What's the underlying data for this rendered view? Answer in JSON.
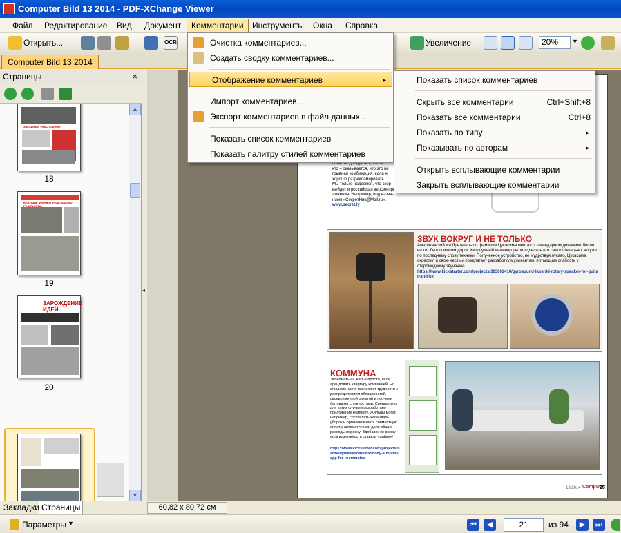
{
  "window": {
    "title": "Computer Bild 13 2014 - PDF-XChange Viewer"
  },
  "menubar": {
    "items": [
      "Файл",
      "Редактирование",
      "Вид",
      "Документ",
      "Комментарии",
      "Инструменты",
      "Окна",
      "Справка"
    ],
    "active_index": 4
  },
  "toolbar": {
    "open_label": "Открыть...",
    "ocr_label": "OCR",
    "zoom_label": "Увеличение",
    "zoom_value": "20%"
  },
  "doctab": {
    "label": "Computer Bild 13 2014"
  },
  "sidepanel": {
    "title": "Страницы",
    "close": "×",
    "pages": [
      {
        "num": "18",
        "headline": "ЗВЁЗДНЫЙ «НАСЛЕДНИК»"
      },
      {
        "num": "19",
        "headline": "ВЕДУЩИЕ ФИРМЫ ПРЕДСТАВЛЯЮТ РЕЗУЛЬТАТЫ"
      },
      {
        "num": "20",
        "headline": "ЗАРОЖДЕНИЕ ИДЕЙ"
      },
      {
        "num": "21",
        "headline": ""
      }
    ],
    "selected_page": "21"
  },
  "sidetabs": [
    "Закладки",
    "Страницы"
  ],
  "dimensions": "60,82 x 80,72 см",
  "statusbar": {
    "params_label": "Параметры",
    "current_page": "21",
    "of_label": "из 94"
  },
  "comments_menu": {
    "items": [
      {
        "label": "Очистка комментариев...",
        "icon": "eraser-icon"
      },
      {
        "label": "Создать сводку комментариев...",
        "icon": "summary-icon"
      },
      {
        "label": "Отображение комментариев",
        "submenu": true,
        "highlighted": true
      },
      {
        "label": "Импорт комментариев...",
        "icon": ""
      },
      {
        "label": "Экспорт комментариев в файл данных...",
        "icon": "export-icon"
      },
      {
        "label": "Показать список комментариев",
        "icon": ""
      },
      {
        "label": "Показать палитру стилей комментариев",
        "icon": ""
      }
    ]
  },
  "display_submenu": {
    "items": [
      {
        "label": "Показать список комментариев",
        "shortcut": ""
      },
      {
        "label": "Скрыть все комментарии",
        "shortcut": "Ctrl+Shift+8"
      },
      {
        "label": "Показать все комментарии",
        "shortcut": "Ctrl+8"
      },
      {
        "label": "Показать по типу",
        "submenu": true
      },
      {
        "label": "Показывать по авторам",
        "submenu": true
      },
      {
        "label": "Открыть всплывающие комментарии",
        "shortcut": ""
      },
      {
        "label": "Закрыть всплывающие комментарии",
        "shortcut": ""
      }
    ]
  },
  "article": {
    "top_text": [
      "попыток догадаться, кто вст",
      "кто – оказывается, что это ве",
      "грывная комбинация, если н",
      "хорошо разрекламировать.",
      "Мы только надеемся, что скор",
      "выйдет и российская версия при-",
      "ложения. Например, под назва-",
      "нием «СекретНик@Mail.ru».",
      "www.secret.ly"
    ],
    "sound_title": "ЗВУК ВОКРУГ И НЕ ТОЛЬКО",
    "sound_body": "Американский изобретатель по фамилии Цукасима мечтал о легендарном динамике Лесли, но тот был слишком дорог. Хитроумный инженер решил сделать его самостоятельно, но уже по последнему слову техники. Полученное устройство, не мудрствуя лукаво, Цукасима окрестил в свою честь и предлагает разработку музыкантам, питающим слабость к старомодному звучанию.",
    "sound_link": "https://www.kickstarter.com/projects/303692410/gyrosound-labs-3d-rotary-speaker-for-guitar-and-ke",
    "kommuna_title": "КОММУНА",
    "kommuna_body": "Экономить на жилье просто, если арендовать квартиру компанией. Но слишком часто возникают трудности с распределением обязанностей, своевременной оплатой и прочими бытовыми сложностями. Специально для таких случаев разработано приложение Harmony. Жильцы могут, например, составлять календарь уборок и организовывать совместную оплату, автоматически деля общие расходы поровну. Вдобавок ко всему есть возможность ставить «лайки»!",
    "kommuna_link": "https://www.kickstarter.com/projects/harmonyisawesome/harmony-a-mobile-app-for-roommates",
    "footer_issue": "13/2014",
    "footer_brand": "Computer",
    "footer_page": "25"
  }
}
